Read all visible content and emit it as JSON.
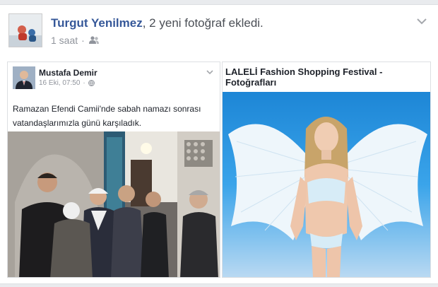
{
  "story": {
    "author": "Turgut Yenilmez",
    "action_text": ", 2 yeni fotoğraf ekledi.",
    "time": "1 saat",
    "separator": "·",
    "audience_icon": "friends-icon",
    "menu_icon": "chevron-down-icon"
  },
  "shared_post": {
    "author": "Mustafa Demir",
    "date": "16 Eki, 07:50",
    "separator": "·",
    "privacy_icon": "globe-icon",
    "text_line1": "Ramazan Efendi Camii'nde sabah namazı sonrası",
    "text_line2": "vatandaşlarımızla günü karşıladık."
  },
  "article": {
    "title": "LALELİ Fashion Shopping Festival - Fotoğrafları"
  },
  "colors": {
    "link_blue": "#365899",
    "meta_gray": "#90949c",
    "border": "#dddfe2",
    "feed_bg": "#e9ebee"
  }
}
